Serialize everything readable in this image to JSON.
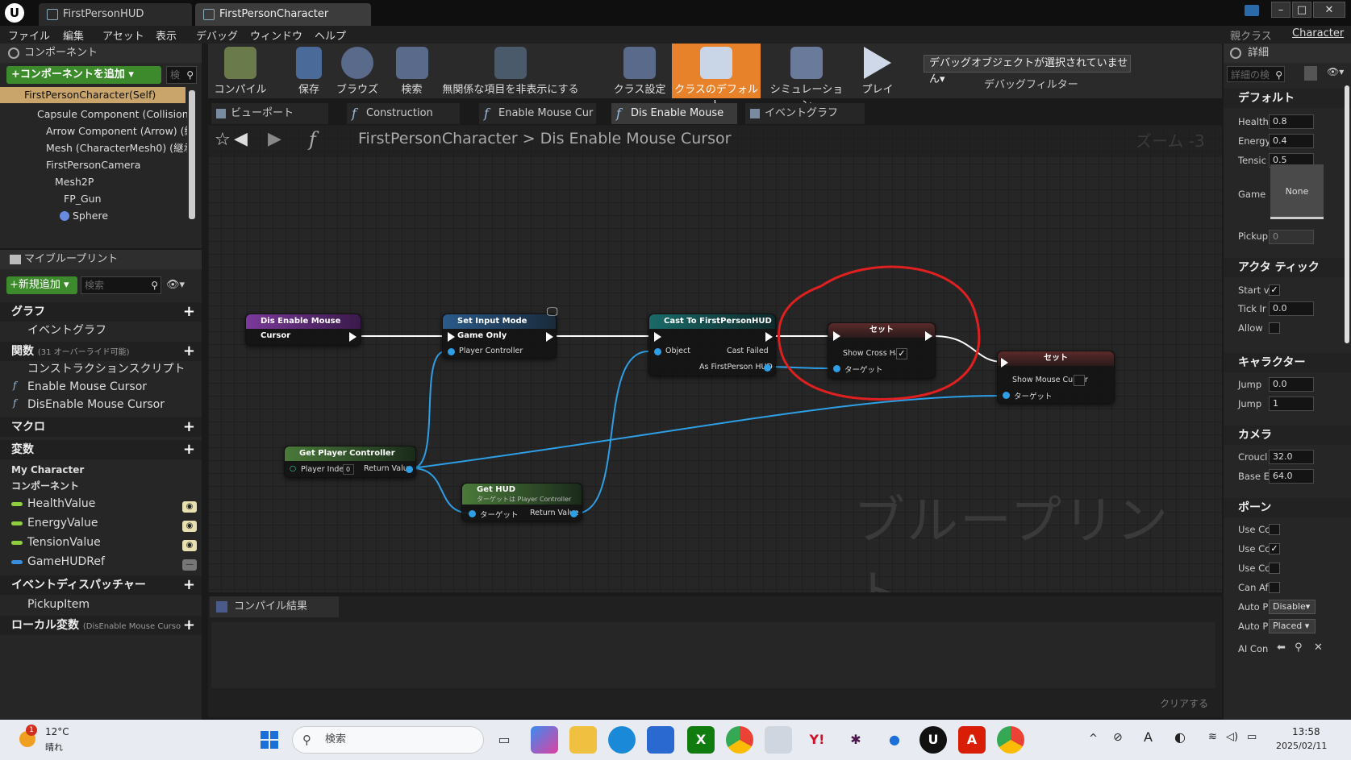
{
  "title_bar": {
    "tabs": [
      {
        "label": "FirstPersonHUD"
      },
      {
        "label": "FirstPersonCharacter"
      }
    ],
    "parent_class_prefix": "親クラス",
    "parent_class": "Character"
  },
  "menu": [
    "ファイル",
    "編集",
    "アセット",
    "表示",
    "デバッグ",
    "ウィンドウ",
    "ヘルプ"
  ],
  "components_panel": {
    "title": "コンポーネント",
    "add_button": "+コンポーネントを追加 ▾",
    "search_placeholder": "検",
    "self_row": "FirstPersonCharacter(Self)",
    "tree": [
      "Capsule Component (Collision",
      "Arrow Component (Arrow) (継",
      "Mesh (CharacterMesh0) (継承",
      "FirstPersonCamera",
      "Mesh2P",
      "FP_Gun",
      "Sphere"
    ]
  },
  "my_blueprint": {
    "title": "マイブループリント",
    "add_new": "+新規追加 ▾",
    "search_placeholder": "検索",
    "graphs_header": "グラフ",
    "event_graph": "イベントグラフ",
    "functions_header": "関数",
    "functions_note": "(31 オーバーライド可能)",
    "functions": [
      "コンストラクションスクリプト",
      "Enable Mouse Cursor",
      "DisEnable Mouse Cursor"
    ],
    "macros_header": "マクロ",
    "variables_header": "変数",
    "my_character": "My Character",
    "components_sub": "コンポーネント",
    "variables": [
      "HealthValue",
      "EnergyValue",
      "TensionValue",
      "GameHUDRef"
    ],
    "dispatchers_header": "イベントディスパッチャー",
    "dispatchers": [
      "PickupItem"
    ],
    "local_vars_header": "ローカル変数",
    "local_vars_note": "(DisEnable Mouse Curso"
  },
  "toolbar": {
    "buttons": [
      "コンパイル",
      "保存",
      "ブラウズ",
      "検索",
      "無関係な項目を非表示にする",
      "クラス設定",
      "クラスのデフォルト",
      "シミュレーション",
      "プレイ"
    ],
    "debug_dropdown": "デバッグオブジェクトが選択されていません▾",
    "debug_filter": "デバッグフィルター"
  },
  "graph_tabs": [
    "ビューポート",
    "Construction Scrip",
    "Enable Mouse Cur",
    "Dis Enable Mouse",
    "イベントグラフ"
  ],
  "breadcrumb": {
    "root": "FirstPersonCharacter",
    "separator": ">",
    "current": "Dis Enable Mouse Cursor",
    "zoom": "ズーム -3"
  },
  "graph": {
    "watermark": "ブループリント",
    "nodes": {
      "entry": {
        "title": "Dis Enable Mouse Cursor"
      },
      "set_input": {
        "title": "Set Input Mode Game Only",
        "pin": "Player Controller"
      },
      "cast": {
        "title": "Cast To FirstPersonHUD",
        "pin_object": "Object",
        "pin_failed": "Cast Failed",
        "pin_as": "As FirstPerson HUD"
      },
      "set1": {
        "title": "セット",
        "pin_value": "Show Cross Hair",
        "pin_target": "ターゲット",
        "checked": true
      },
      "set2": {
        "title": "セット",
        "pin_value": "Show Mouse Cursor",
        "pin_target": "ターゲット",
        "checked": false
      },
      "get_pc": {
        "title": "Get Player Controller",
        "pin_index": "Player Index",
        "index_value": "0",
        "pin_return": "Return Value"
      },
      "get_hud": {
        "title": "Get HUD",
        "subtitle": "ターゲットは Player Controller",
        "pin_target": "ターゲット",
        "pin_return": "Return Value"
      }
    }
  },
  "compile_panel": {
    "tab": "コンパイル結果",
    "clear": "クリアする"
  },
  "details": {
    "title": "詳細",
    "search_placeholder": "詳細の検",
    "default_header": "デフォルト",
    "default_rows": [
      {
        "label": "Health",
        "value": "0.8"
      },
      {
        "label": "Energy",
        "value": "0.4"
      },
      {
        "label": "Tensic",
        "value": "0.5"
      }
    ],
    "game_label": "Game",
    "game_value": "None",
    "pickup_label": "Pickup",
    "pickup_value": "0",
    "actor_tick_header": "アクタ ティック",
    "start_label": "Start v",
    "tick_label": "Tick Ir",
    "tick_value": "0.0",
    "allow_label": "Allow",
    "character_header": "キャラクター",
    "jump1_label": "Jump",
    "jump1_value": "0.0",
    "jump2_label": "Jump",
    "jump2_value": "1",
    "camera_header": "カメラ",
    "crouch_label": "Croucl",
    "crouch_value": "32.0",
    "base_label": "Base E",
    "base_value": "64.0",
    "pawn_header": "ポーン",
    "use1": "Use Cc",
    "use2": "Use Cc",
    "use3": "Use Cc",
    "can_af": "Can Af",
    "auto_p1": "Auto P",
    "auto_p1_value": "Disable▾",
    "auto_p2": "Auto P",
    "auto_p2_value": "Placed ▾",
    "ai_con": "AI Con"
  },
  "taskbar": {
    "weather_temp": "12°C",
    "weather_desc": "晴れ",
    "search_placeholder": "検索",
    "time": "13:58",
    "date": "2025/02/11",
    "notification_badge": "1"
  }
}
